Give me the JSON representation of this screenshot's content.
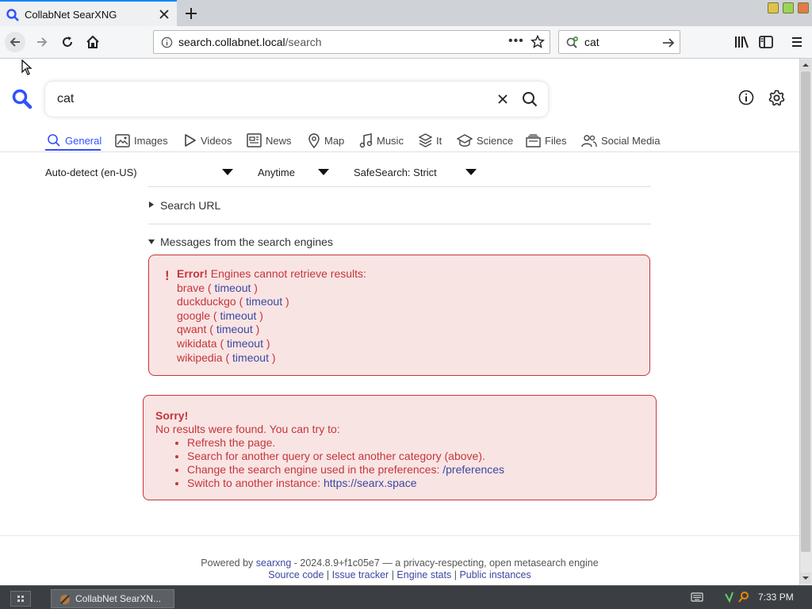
{
  "browser": {
    "tab_title": "CollabNet SearXNG",
    "url_domain": "search.collabnet.local",
    "url_path": "/search",
    "url_dots": "•••",
    "search_box_value": "cat"
  },
  "search": {
    "query": "cat"
  },
  "categories": [
    {
      "label": "General",
      "icon": "search-icon",
      "active": true
    },
    {
      "label": "Images",
      "icon": "image-icon"
    },
    {
      "label": "Videos",
      "icon": "play-icon"
    },
    {
      "label": "News",
      "icon": "newspaper-icon"
    },
    {
      "label": "Map",
      "icon": "map-pin-icon"
    },
    {
      "label": "Music",
      "icon": "music-icon"
    },
    {
      "label": "It",
      "icon": "layers-icon"
    },
    {
      "label": "Science",
      "icon": "graduation-cap-icon"
    },
    {
      "label": "Files",
      "icon": "files-icon"
    },
    {
      "label": "Social Media",
      "icon": "people-icon"
    }
  ],
  "filters": {
    "language": "Auto-detect (en-US)",
    "time": "Anytime",
    "safesearch": "SafeSearch: Strict"
  },
  "search_url_label": "Search URL",
  "messages_label": "Messages from the search engines",
  "error": {
    "title": "Error!",
    "text": "Engines cannot retrieve results:",
    "engines": [
      {
        "name": "brave",
        "reason": "timeout"
      },
      {
        "name": "duckduckgo",
        "reason": "timeout"
      },
      {
        "name": "google",
        "reason": "timeout"
      },
      {
        "name": "qwant",
        "reason": "timeout"
      },
      {
        "name": "wikidata",
        "reason": "timeout"
      },
      {
        "name": "wikipedia",
        "reason": "timeout"
      }
    ]
  },
  "sorry": {
    "title": "Sorry!",
    "text": "No results were found. You can try to:",
    "item1": "Refresh the page.",
    "item2": "Search for another query or select another category (above).",
    "item3_text": "Change the search engine used in the preferences:",
    "item3_link": "/preferences",
    "item4_text": "Switch to another instance:",
    "item4_link": "https://searx.space"
  },
  "footer": {
    "powered_by": "Powered by",
    "searxng": "searxng",
    "version_text": "- 2024.8.9+f1c05e7 — a privacy-respecting, open metasearch engine",
    "source_code": "Source code",
    "issue_tracker": "Issue tracker",
    "engine_stats": "Engine stats",
    "public_instances": "Public instances",
    "separator": "|"
  },
  "taskbar": {
    "task_label": "CollabNet SearXN...",
    "clock": "7:33 PM"
  },
  "colors": {
    "accent": "#3050ff",
    "error_red": "#c4363a",
    "error_bg": "#f9e4e4",
    "link": "#3b48a0"
  }
}
